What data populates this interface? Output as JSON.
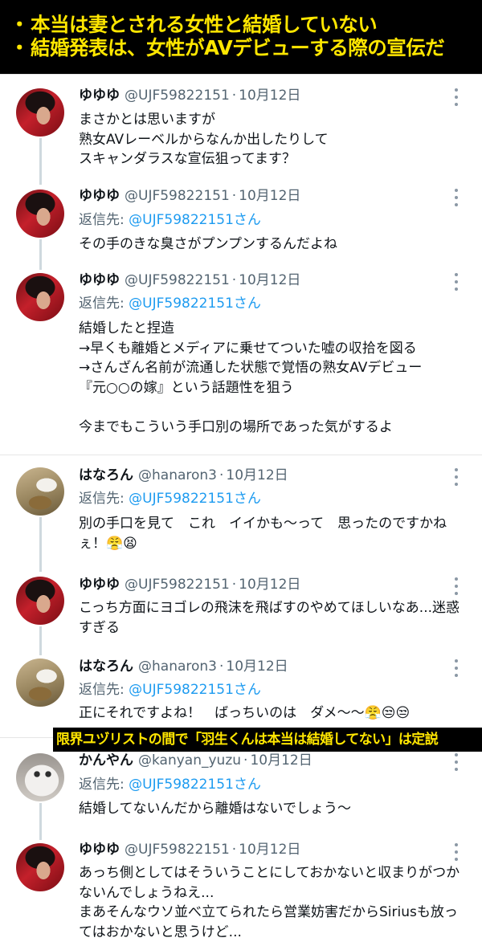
{
  "banner": {
    "line1": "本当は妻とされる女性と結婚していない",
    "line2": "結婚発表は、女性がAVデビューする際の宣伝だ",
    "bullet": "・"
  },
  "caption": "限界ユヅリストの間で「羽生くんは本当は結婚してない」は定説",
  "colors": {
    "banner_text": "#ffe600",
    "mention": "#1d9bf0",
    "muted": "#536471"
  },
  "icons": {
    "more": "more-vertical-icon"
  },
  "thread1": {
    "tweets": [
      {
        "name": "ゆゆゆ",
        "handle": "@UJF59822151",
        "date": "10月12日",
        "body": "まさかとは思いますが\n熟女AVレーベルからなんか出したりして\nスキャンダラスな宣伝狙ってます？"
      },
      {
        "name": "ゆゆゆ",
        "handle": "@UJF59822151",
        "date": "10月12日",
        "reply_label": "返信先:",
        "reply_to": "@UJF59822151さん",
        "body": "その手のきな臭さがプンプンするんだよね"
      },
      {
        "name": "ゆゆゆ",
        "handle": "@UJF59822151",
        "date": "10月12日",
        "reply_label": "返信先:",
        "reply_to": "@UJF59822151さん",
        "body": "結婚したと捏造\n→早くも離婚とメディアに乗せてついた嘘の収拾を図る\n→さんざん名前が流通した状態で覚悟の熟女AVデビュー\n『元○○の嫁』という話題性を狙う\n\n今までもこういう手口別の場所であった気がするよ"
      }
    ]
  },
  "thread2": {
    "tweets": [
      {
        "name": "はなろん",
        "handle": "@hanaron3",
        "date": "10月12日",
        "reply_label": "返信先:",
        "reply_to": "@UJF59822151さん",
        "body": "別の手口を見て　これ　イイかも〜って　思ったのですかね\nぇ！😤😫"
      },
      {
        "name": "ゆゆゆ",
        "handle": "@UJF59822151",
        "date": "10月12日",
        "body": "こっち方面にヨゴレの飛沫を飛ばすのやめてほしいなあ...迷惑\nすぎる"
      },
      {
        "name": "はなろん",
        "handle": "@hanaron3",
        "date": "10月12日",
        "reply_label": "返信先:",
        "reply_to": "@UJF59822151さん",
        "body": "正にそれですよね！　ばっちいのは　ダメ〜〜😤😒😒"
      }
    ]
  },
  "thread3": {
    "tweets": [
      {
        "name": "かんやん",
        "handle": "@kanyan_yuzu",
        "date": "10月12日",
        "reply_label": "返信先:",
        "reply_to": "@UJF59822151さん",
        "body": "結婚してないんだから離婚はないでしょう〜"
      },
      {
        "name": "ゆゆゆ",
        "handle": "@UJF59822151",
        "date": "10月12日",
        "body": "あっち側としてはそういうことにしておかないと収まりがつか\nないんでしょうねえ...\nまあそんなウソ並べ立てられたら営業妨害だからSiriusも放っ\nてはおかないと思うけど..."
      }
    ]
  }
}
